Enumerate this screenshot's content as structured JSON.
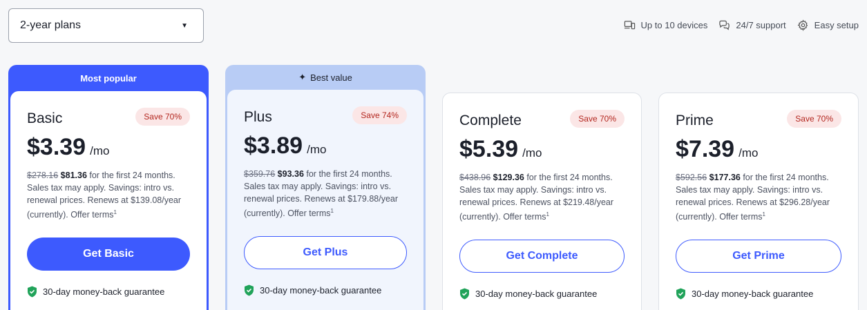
{
  "plan_select": {
    "value": "2-year plans"
  },
  "features": [
    {
      "icon": "devices-icon",
      "label": "Up to 10 devices"
    },
    {
      "icon": "chat-icon",
      "label": "24/7 support"
    },
    {
      "icon": "gear-icon",
      "label": "Easy setup"
    }
  ],
  "colors": {
    "accent": "#3d5afe",
    "best_value_banner": "#b8ccf5",
    "save_badge_bg": "#fbe6e6",
    "save_badge_text": "#b3261e",
    "shield": "#21a35a"
  },
  "plans": [
    {
      "banner": "Most popular",
      "name": "Basic",
      "save": "Save 70%",
      "price": "$3.39",
      "per": "/mo",
      "old_total": "$278.16",
      "new_total": "$81.36",
      "details_rest": " for the first 24 months. Sales tax may apply. Savings: intro vs. renewal prices. Renews at $139.08/year (currently). Offer terms",
      "sup": "1",
      "cta": "Get Basic",
      "guarantee": "30-day money-back guarantee"
    },
    {
      "banner": "Best value",
      "name": "Plus",
      "save": "Save 74%",
      "price": "$3.89",
      "per": "/mo",
      "old_total": "$359.76",
      "new_total": "$93.36",
      "details_rest": " for the first 24 months. Sales tax may apply. Savings: intro vs. renewal prices. Renews at $179.88/year (currently). Offer terms",
      "sup": "1",
      "cta": "Get Plus",
      "guarantee": "30-day money-back guarantee"
    },
    {
      "name": "Complete",
      "save": "Save 70%",
      "price": "$5.39",
      "per": "/mo",
      "old_total": "$438.96",
      "new_total": "$129.36",
      "details_rest": " for the first 24 months. Sales tax may apply. Savings: intro vs. renewal prices. Renews at $219.48/year (currently). Offer terms",
      "sup": "1",
      "cta": "Get Complete",
      "guarantee": "30-day money-back guarantee"
    },
    {
      "name": "Prime",
      "save": "Save 70%",
      "price": "$7.39",
      "per": "/mo",
      "old_total": "$592.56",
      "new_total": "$177.36",
      "details_rest": " for the first 24 months. Sales tax may apply. Savings: intro vs. renewal prices. Renews at $296.28/year (currently). Offer terms",
      "sup": "1",
      "cta": "Get Prime",
      "guarantee": "30-day money-back guarantee"
    }
  ]
}
